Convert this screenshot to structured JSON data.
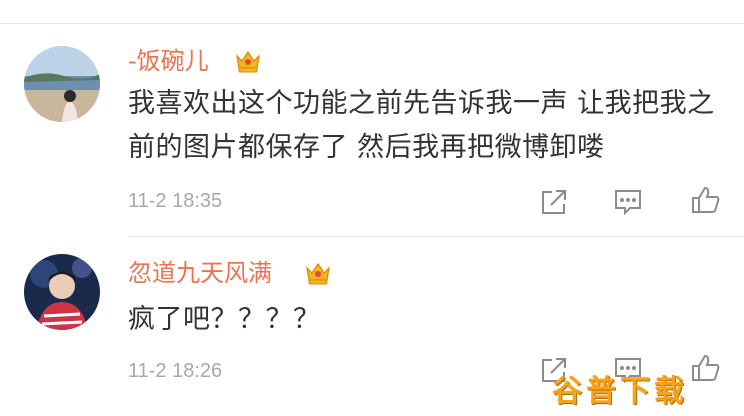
{
  "comments": [
    {
      "username": "-饭碗儿",
      "badge_icon": "crown-icon",
      "content": "我喜欢出这个功能之前先告诉我一声 让我把我之前的图片都保存了 然后我再把微博卸喽",
      "time": "11-2 18:35",
      "actions": [
        "share-icon",
        "comment-icon",
        "like-icon"
      ]
    },
    {
      "username": "忽道九天风满",
      "badge_icon": "crown-icon",
      "content": "疯了吧？？？？",
      "time": "11-2 18:26",
      "actions": [
        "share-icon",
        "comment-icon",
        "like-icon"
      ]
    }
  ],
  "watermark": "谷普下载",
  "colors": {
    "username": "#eb7350",
    "text": "#333333",
    "time": "#a8a8a8",
    "watermark": "#f5a31a"
  }
}
